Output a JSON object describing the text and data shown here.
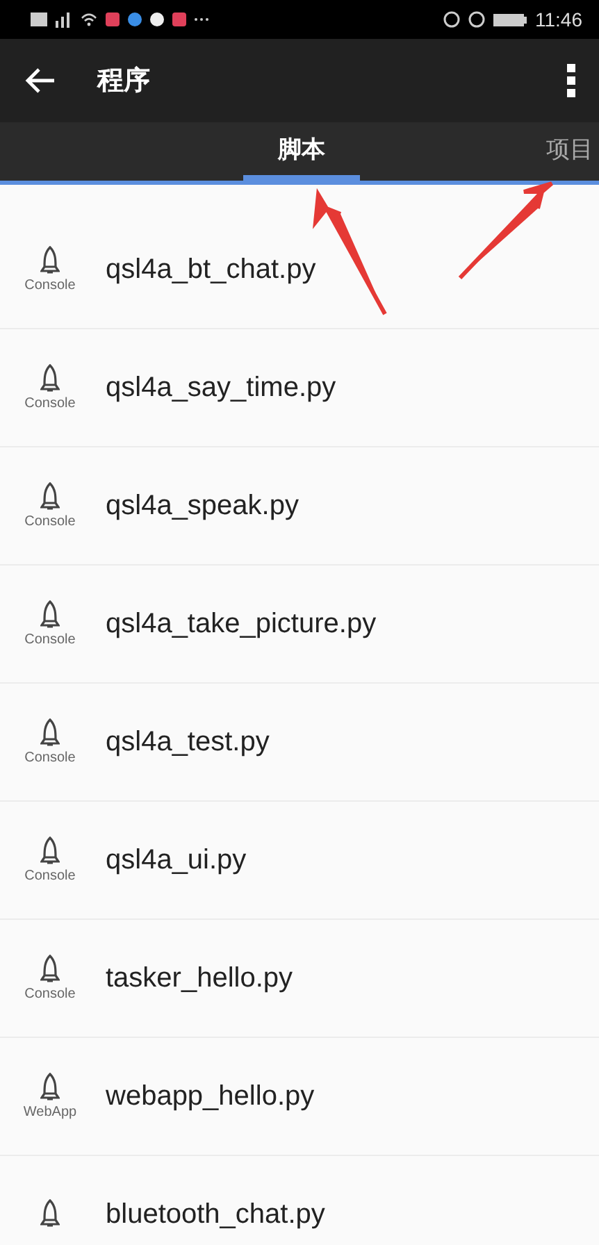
{
  "status_bar": {
    "time": "11:46"
  },
  "app_bar": {
    "title": "程序"
  },
  "tabs": [
    {
      "label": "脚本",
      "selected": true
    },
    {
      "label": "项目",
      "selected": false
    }
  ],
  "scripts": [
    {
      "name": "qsl4a_bt_chat.py",
      "type": "Console"
    },
    {
      "name": "qsl4a_say_time.py",
      "type": "Console"
    },
    {
      "name": "qsl4a_speak.py",
      "type": "Console"
    },
    {
      "name": "qsl4a_take_picture.py",
      "type": "Console"
    },
    {
      "name": "qsl4a_test.py",
      "type": "Console"
    },
    {
      "name": "qsl4a_ui.py",
      "type": "Console"
    },
    {
      "name": "tasker_hello.py",
      "type": "Console"
    },
    {
      "name": "webapp_hello.py",
      "type": "WebApp"
    },
    {
      "name": "bluetooth_chat.py"
    }
  ]
}
